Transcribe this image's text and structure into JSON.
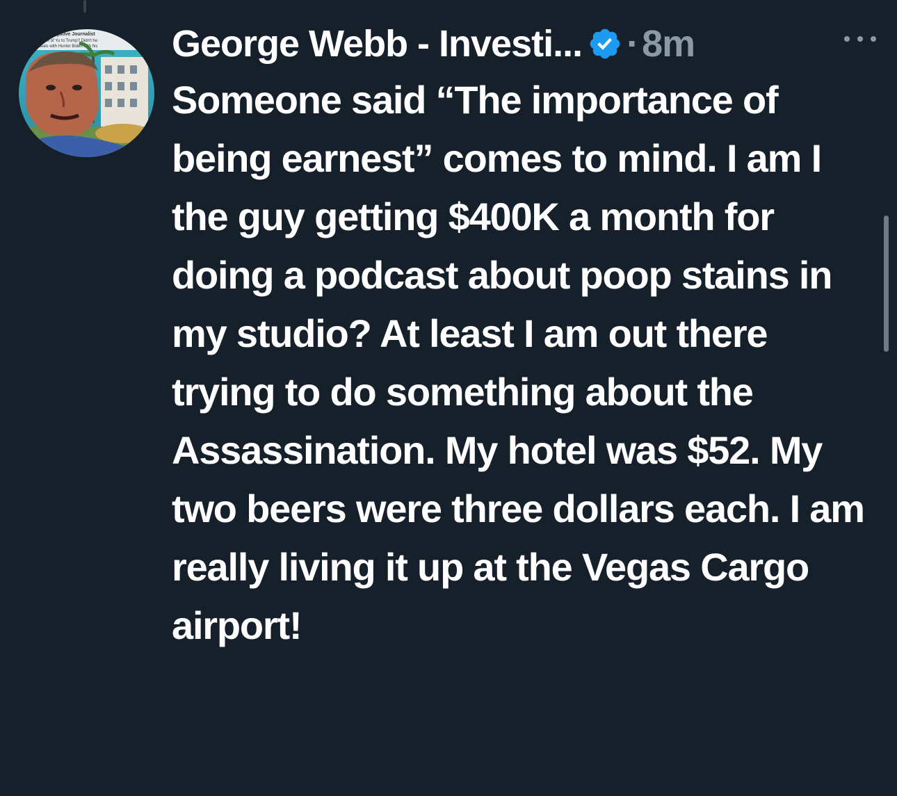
{
  "tweet": {
    "author_name": "George Webb - Investi...",
    "separator": "·",
    "timestamp": "8m",
    "text": "Someone said “The importance of being earnest” comes to mind. I am I the guy getting $400K a month for doing a podcast about poop stains in my studio?  At least I am out there trying to do something about the Assassination.  My hotel was $52.  My two beers were three dollars each.  I am really living it up at the Vegas Cargo airport!",
    "icons": {
      "verified": "verified-badge-icon",
      "more": "more-options-icon"
    }
  },
  "avatar_banner": {
    "line1": "estigative Journalist",
    "line2": "Name of Yu to Trump?  Didn't he",
    "line3": "tions deals with Hunter Biden with his"
  },
  "colors": {
    "background": "#15202b",
    "text": "#ffffff",
    "secondary": "#8b98a5",
    "verified": "#1d9bf0"
  }
}
